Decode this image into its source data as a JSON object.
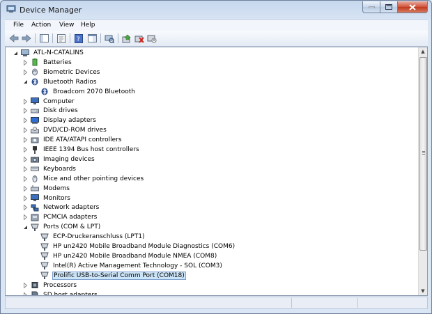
{
  "window": {
    "title": "Device Manager"
  },
  "menu": [
    {
      "label": "File"
    },
    {
      "label": "Action"
    },
    {
      "label": "View"
    },
    {
      "label": "Help"
    }
  ],
  "toolbar": [
    {
      "icon": "back-arrow-icon"
    },
    {
      "icon": "forward-arrow-icon"
    },
    {
      "icon": "show-hide-tree-icon"
    },
    {
      "icon": "properties-icon"
    },
    {
      "icon": "help-icon"
    },
    {
      "icon": "action-pane-icon"
    },
    {
      "icon": "scan-hardware-icon"
    },
    {
      "icon": "update-driver-icon"
    },
    {
      "icon": "uninstall-icon"
    },
    {
      "icon": "disable-device-icon"
    }
  ],
  "tree": [
    {
      "label": "ATL-N-CATALINS",
      "level": 0,
      "state": "expanded",
      "icon": "computer-icon"
    },
    {
      "label": "Batteries",
      "level": 1,
      "state": "collapsed",
      "icon": "battery-icon"
    },
    {
      "label": "Biometric Devices",
      "level": 1,
      "state": "collapsed",
      "icon": "fingerprint-icon"
    },
    {
      "label": "Bluetooth Radios",
      "level": 1,
      "state": "expanded",
      "icon": "bluetooth-icon"
    },
    {
      "label": "Broadcom 2070 Bluetooth",
      "level": 2,
      "state": "leaf",
      "icon": "bluetooth-icon"
    },
    {
      "label": "Computer",
      "level": 1,
      "state": "collapsed",
      "icon": "monitor-icon"
    },
    {
      "label": "Disk drives",
      "level": 1,
      "state": "collapsed",
      "icon": "disk-drive-icon"
    },
    {
      "label": "Display adapters",
      "level": 1,
      "state": "collapsed",
      "icon": "display-adapter-icon"
    },
    {
      "label": "DVD/CD-ROM drives",
      "level": 1,
      "state": "collapsed",
      "icon": "dvd-icon"
    },
    {
      "label": "IDE ATA/ATAPI controllers",
      "level": 1,
      "state": "collapsed",
      "icon": "ide-controller-icon"
    },
    {
      "label": "IEEE 1394 Bus host controllers",
      "level": 1,
      "state": "collapsed",
      "icon": "firewire-icon"
    },
    {
      "label": "Imaging devices",
      "level": 1,
      "state": "collapsed",
      "icon": "camera-icon"
    },
    {
      "label": "Keyboards",
      "level": 1,
      "state": "collapsed",
      "icon": "keyboard-icon"
    },
    {
      "label": "Mice and other pointing devices",
      "level": 1,
      "state": "collapsed",
      "icon": "mouse-icon"
    },
    {
      "label": "Modems",
      "level": 1,
      "state": "collapsed",
      "icon": "modem-icon"
    },
    {
      "label": "Monitors",
      "level": 1,
      "state": "collapsed",
      "icon": "monitor-icon"
    },
    {
      "label": "Network adapters",
      "level": 1,
      "state": "collapsed",
      "icon": "network-icon"
    },
    {
      "label": "PCMCIA adapters",
      "level": 1,
      "state": "collapsed",
      "icon": "pcmcia-icon"
    },
    {
      "label": "Ports (COM & LPT)",
      "level": 1,
      "state": "expanded",
      "icon": "port-icon"
    },
    {
      "label": "ECP-Druckeranschluss (LPT1)",
      "level": 2,
      "state": "leaf",
      "icon": "port-icon"
    },
    {
      "label": "HP un2420 Mobile Broadband Module Diagnostics (COM6)",
      "level": 2,
      "state": "leaf",
      "icon": "port-icon"
    },
    {
      "label": "HP un2420 Mobile Broadband Module NMEA (COM8)",
      "level": 2,
      "state": "leaf",
      "icon": "port-icon"
    },
    {
      "label": "Intel(R) Active Management Technology - SOL (COM3)",
      "level": 2,
      "state": "leaf",
      "icon": "port-icon"
    },
    {
      "label": "Prolific USB-to-Serial Comm Port (COM18)",
      "level": 2,
      "state": "leaf",
      "icon": "port-icon",
      "selected": true
    },
    {
      "label": "Processors",
      "level": 1,
      "state": "collapsed",
      "icon": "processor-icon"
    },
    {
      "label": "SD host adapters",
      "level": 1,
      "state": "collapsed",
      "icon": "sd-card-icon"
    }
  ],
  "colors": {
    "selection": "#cce4f7",
    "selection_border": "#7da2ce",
    "frame": "#c6d8ee",
    "close_button": "#c03a1f"
  }
}
